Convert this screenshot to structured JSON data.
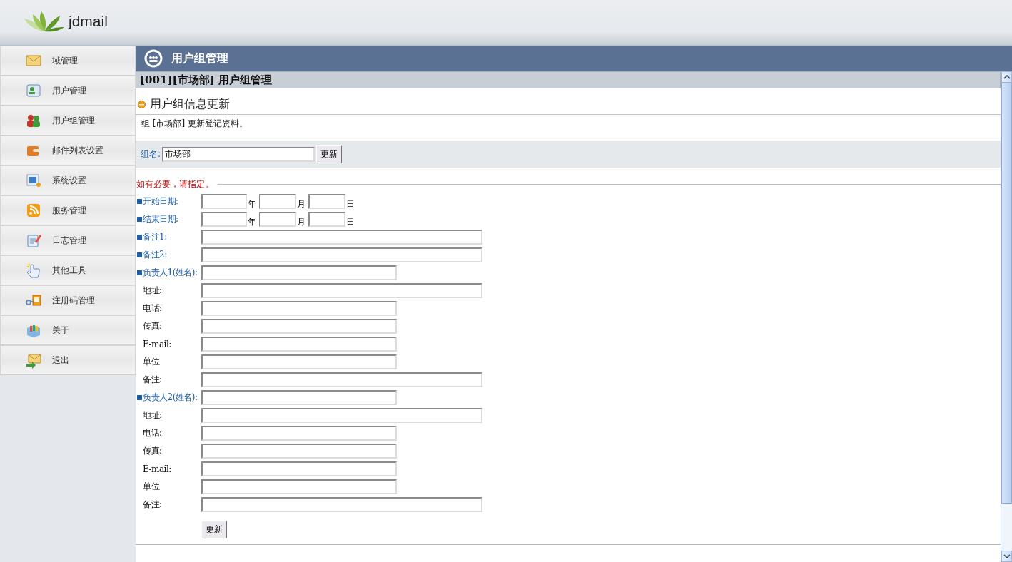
{
  "header": {
    "logo_text": "jdmail"
  },
  "sidebar": {
    "items": [
      {
        "label": "域管理"
      },
      {
        "label": "用户管理"
      },
      {
        "label": "用户组管理"
      },
      {
        "label": "邮件列表设置"
      },
      {
        "label": "系统设置"
      },
      {
        "label": "服务管理"
      },
      {
        "label": "日志管理"
      },
      {
        "label": "其他工具"
      },
      {
        "label": "注册码管理"
      },
      {
        "label": "关于"
      },
      {
        "label": "退出"
      }
    ]
  },
  "page_title": "用户组管理",
  "section_header": "[001][市场部] 用户组管理",
  "form_title": "用户组信息更新",
  "description": "组 [市场部] 更新登记资料。",
  "group_name": {
    "label": "组名:",
    "value": "市场部",
    "button": "更新"
  },
  "optional_note": "如有必要，请指定。",
  "rows": [
    {
      "kind": "date",
      "label": "开始日期:",
      "marked": true,
      "parts": [
        {
          "unit": "年"
        },
        {
          "unit": "月"
        },
        {
          "unit": "日"
        }
      ]
    },
    {
      "kind": "date",
      "label": "结束日期:",
      "marked": true,
      "parts": [
        {
          "unit": "年"
        },
        {
          "unit": "月"
        },
        {
          "unit": "日"
        }
      ]
    },
    {
      "kind": "wide",
      "label": "备注1:",
      "marked": true
    },
    {
      "kind": "wide",
      "label": "备注2:",
      "marked": true
    },
    {
      "kind": "narrow",
      "label": "负责人1(姓名):",
      "marked": true
    },
    {
      "kind": "wide",
      "label": "地址:",
      "marked": false
    },
    {
      "kind": "narrow",
      "label": "电话:",
      "marked": false
    },
    {
      "kind": "narrow",
      "label": "传真:",
      "marked": false
    },
    {
      "kind": "narrow",
      "label": "E-mail:",
      "marked": false
    },
    {
      "kind": "narrow",
      "label": "单位",
      "marked": false
    },
    {
      "kind": "wide",
      "label": "备注:",
      "marked": false
    },
    {
      "kind": "narrow",
      "label": "负责人2(姓名):",
      "marked": true
    },
    {
      "kind": "wide",
      "label": "地址:",
      "marked": false
    },
    {
      "kind": "narrow",
      "label": "电话:",
      "marked": false
    },
    {
      "kind": "narrow",
      "label": "传真:",
      "marked": false
    },
    {
      "kind": "narrow",
      "label": "E-mail:",
      "marked": false
    },
    {
      "kind": "narrow",
      "label": "单位",
      "marked": false
    },
    {
      "kind": "wide",
      "label": "备注:",
      "marked": false
    }
  ],
  "submit_button": "更新"
}
